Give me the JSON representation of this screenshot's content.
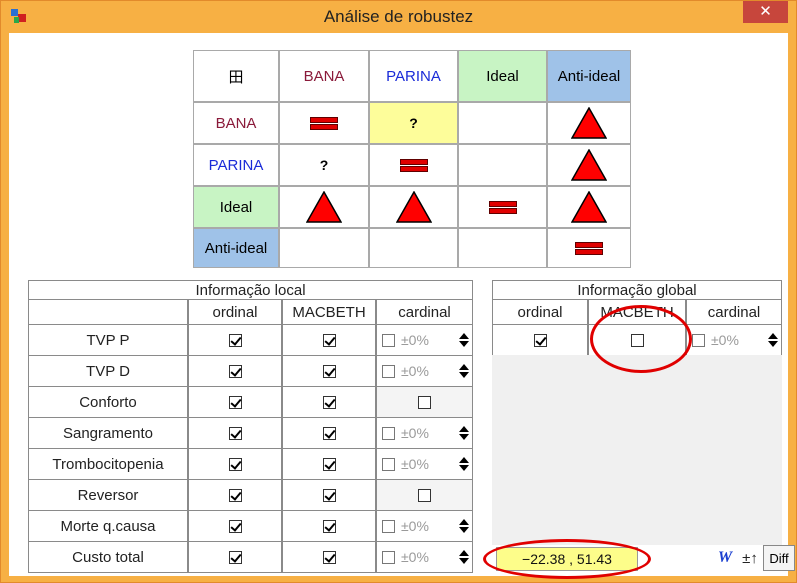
{
  "window": {
    "title": "Análise de robustez",
    "close_label": "✕"
  },
  "matrix": {
    "corner_icon": "田",
    "headers": [
      "BANA",
      "PARINA",
      "Ideal",
      "Anti-ideal"
    ],
    "rows": [
      "BANA",
      "PARINA",
      "Ideal",
      "Anti-ideal"
    ],
    "cells": [
      [
        "equal",
        "?",
        "",
        "triangle"
      ],
      [
        "?",
        "equal",
        "",
        "triangle"
      ],
      [
        "triangle",
        "triangle",
        "equal",
        "triangle"
      ],
      [
        "",
        "",
        "",
        "equal"
      ]
    ]
  },
  "local": {
    "title": "Informação local",
    "col_ordinal": "ordinal",
    "col_macbeth": "MACBETH",
    "col_cardinal": "cardinal",
    "pct_text": "±0%",
    "rows": [
      {
        "label": "TVP P",
        "ordinal": true,
        "macbeth": true,
        "cardinal": "spin"
      },
      {
        "label": "TVP D",
        "ordinal": true,
        "macbeth": true,
        "cardinal": "spin"
      },
      {
        "label": "Conforto",
        "ordinal": true,
        "macbeth": true,
        "cardinal": "disabled"
      },
      {
        "label": "Sangramento",
        "ordinal": true,
        "macbeth": true,
        "cardinal": "spin"
      },
      {
        "label": "Trombocitopenia",
        "ordinal": true,
        "macbeth": true,
        "cardinal": "spin"
      },
      {
        "label": "Reversor",
        "ordinal": true,
        "macbeth": true,
        "cardinal": "disabled"
      },
      {
        "label": "Morte q.causa",
        "ordinal": true,
        "macbeth": true,
        "cardinal": "spin"
      },
      {
        "label": "Custo total",
        "ordinal": true,
        "macbeth": true,
        "cardinal": "spin"
      }
    ]
  },
  "global": {
    "title": "Informação global",
    "col_ordinal": "ordinal",
    "col_macbeth": "MACBETH",
    "col_cardinal": "cardinal",
    "ordinal": true,
    "macbeth": false,
    "pct_text": "±0%"
  },
  "result_value": "−22.38 , 51.43",
  "buttons": {
    "word_label": "W",
    "plusminus_label": "±↑",
    "diff_label": "Diff"
  },
  "colors": {
    "title_bar": "#f7b044",
    "close": "#c7463c",
    "highlight": "#e00000"
  }
}
